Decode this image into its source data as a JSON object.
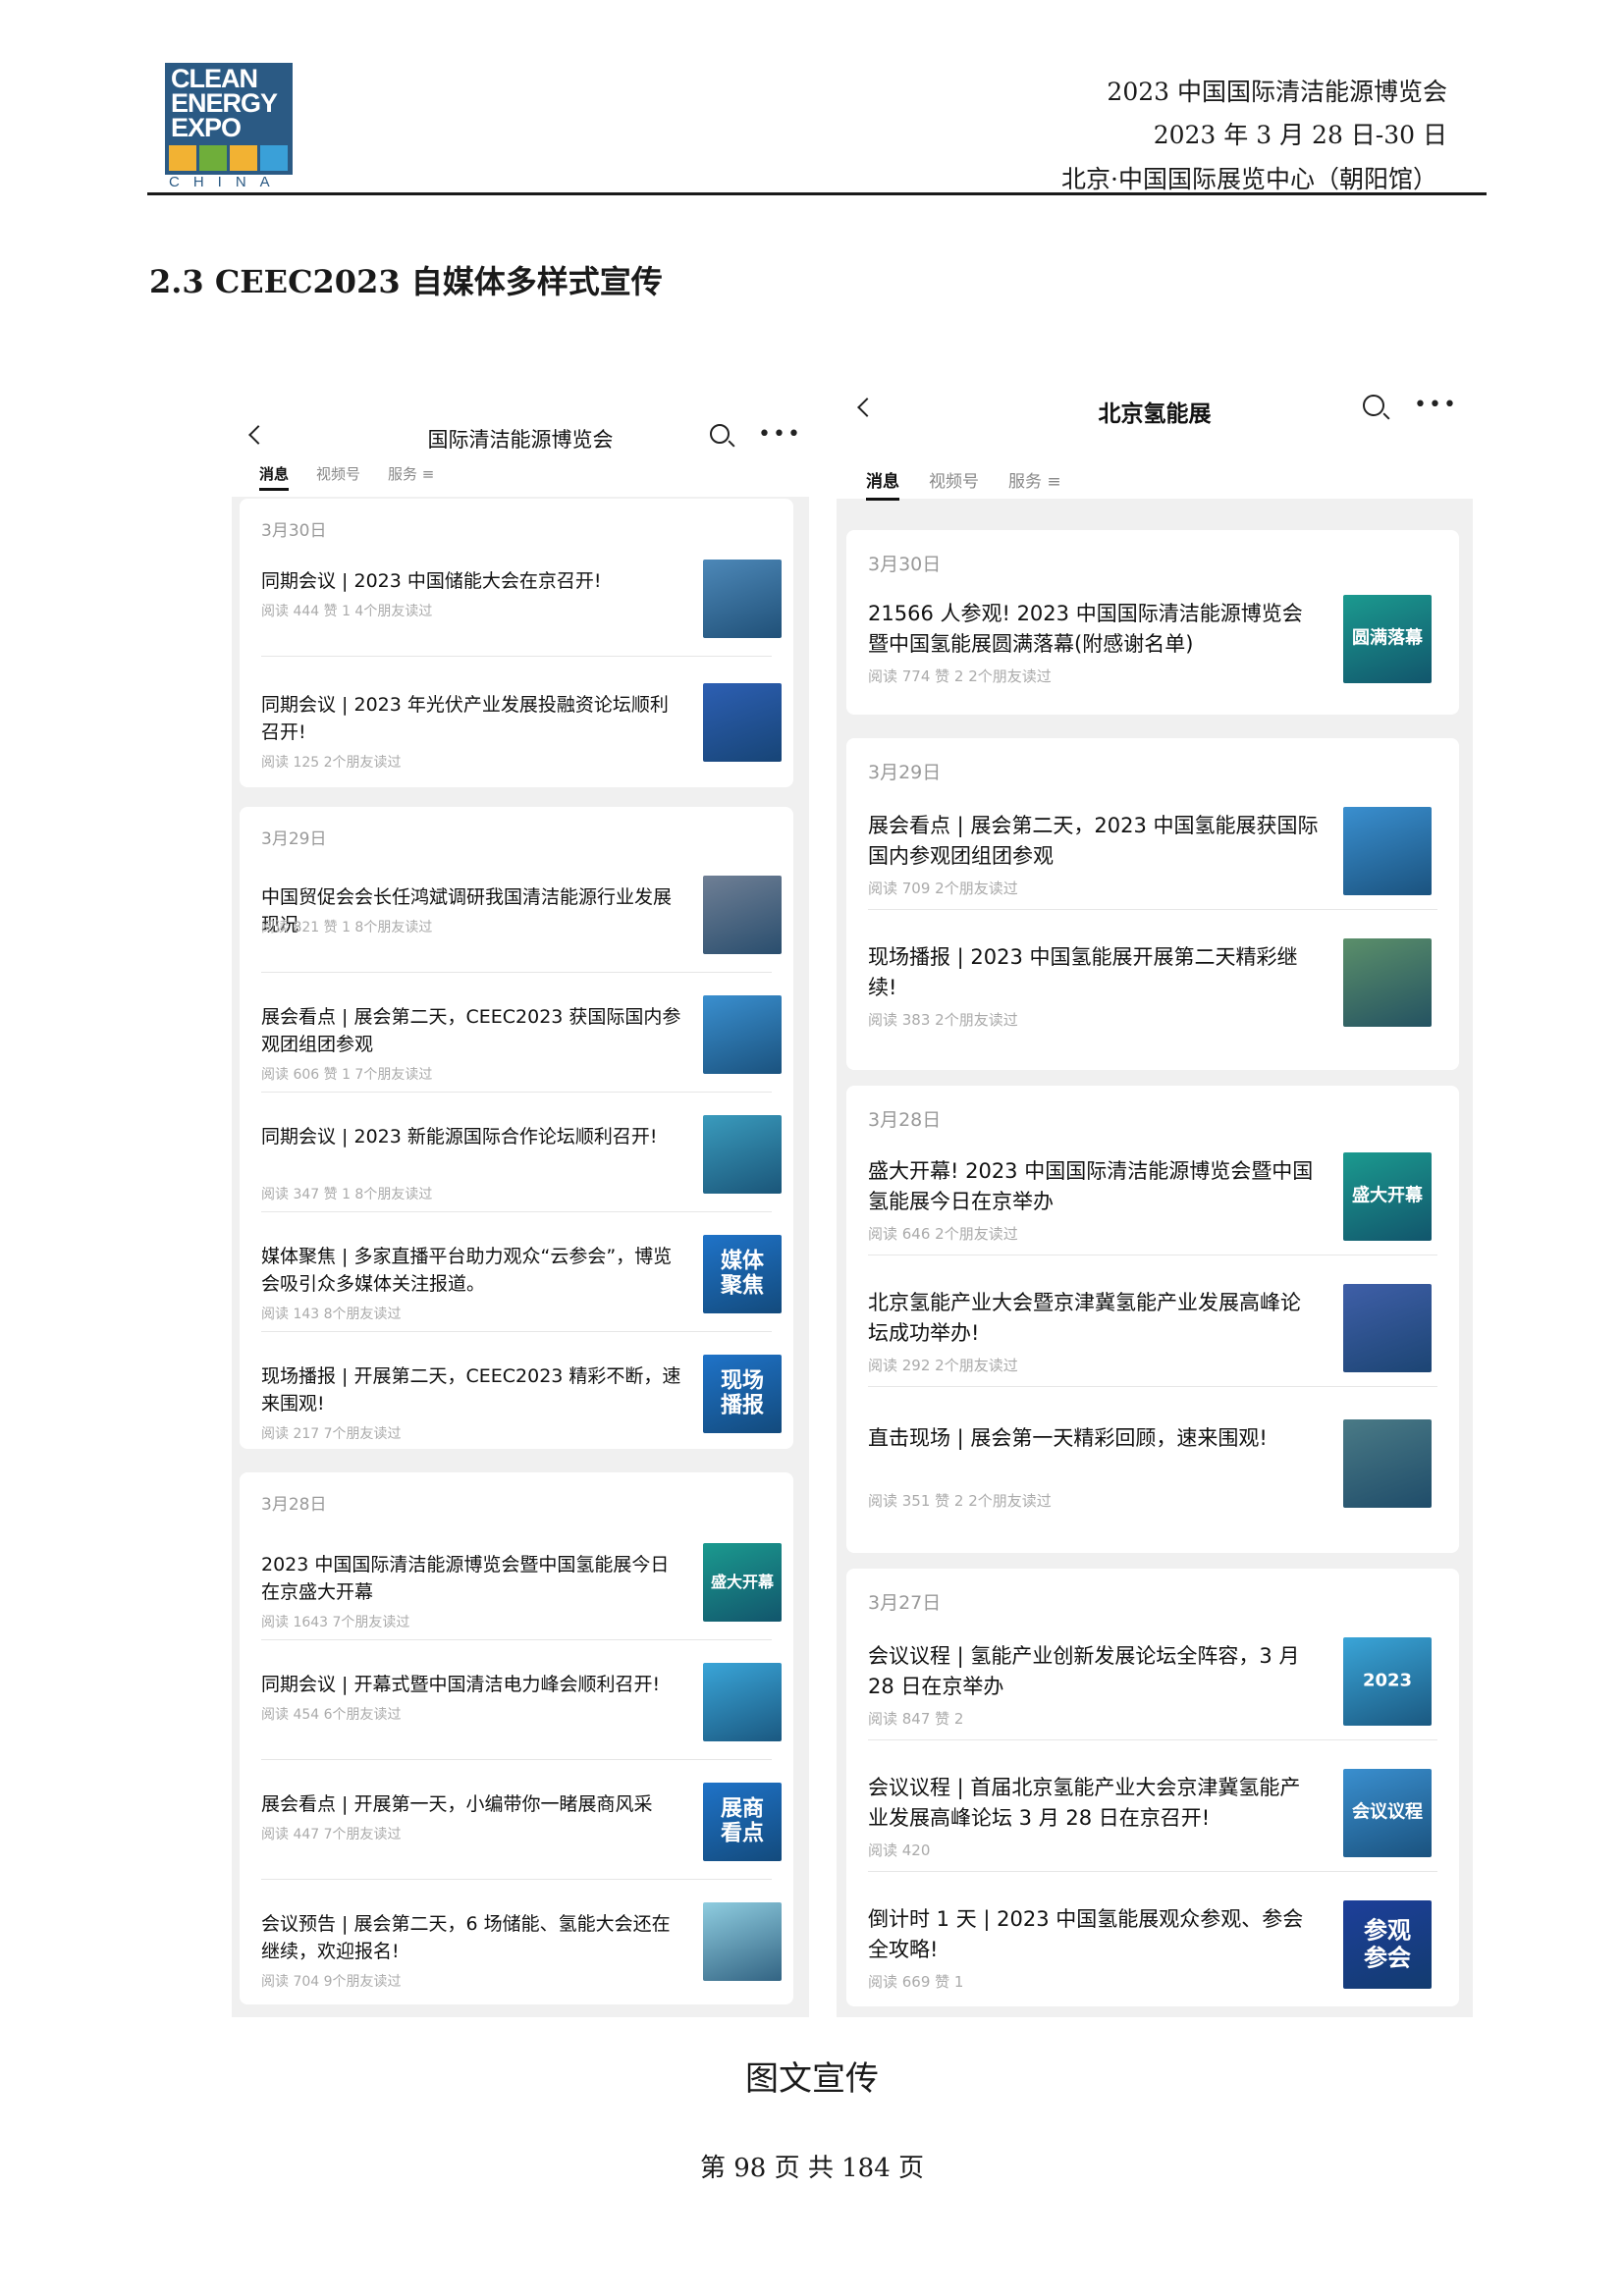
{
  "header": {
    "logo_lines": [
      "CLEAN",
      "ENERGY",
      "EXPO"
    ],
    "logo_bottom": "CHINA",
    "line1": "2023 中国国际清洁能源博览会",
    "line2": "2023 年 3 月 28 日-30 日",
    "line3": "北京·中国国际展览中心（朝阳馆）"
  },
  "section_title": "2.3 CEEC2023 自媒体多样式宣传",
  "left_phone": {
    "title": "国际清洁能源博览会",
    "tabs": [
      "消息",
      "视频号",
      "服务 ≡"
    ],
    "groups": [
      {
        "date": "3月30日",
        "items": [
          {
            "title": "同期会议 | 2023 中国储能大会在京召开!",
            "meta": "阅读 444  赞 1  4个朋友读过",
            "thumb_color": "#4d88b8",
            "thumb_text": ""
          },
          {
            "title": "同期会议 | 2023 年光伏产业发展投融资论坛顺利召开!",
            "meta": "阅读 125  2个朋友读过",
            "thumb_color": "#2d5fb3",
            "thumb_text": ""
          }
        ]
      },
      {
        "date": "3月29日",
        "items": [
          {
            "title": "中国贸促会会长任鸿斌调研我国清洁能源行业发展现况",
            "meta": "阅读 821  赞 1  8个朋友读过",
            "thumb_color": "#6f7f95",
            "thumb_text": ""
          },
          {
            "title": "展会看点 | 展会第二天，CEEC2023 获国际国内参观团组团参观",
            "meta": "阅读 606  赞 1  7个朋友读过",
            "thumb_color": "#3a8fcf",
            "thumb_text": ""
          },
          {
            "title": "同期会议 | 2023 新能源国际合作论坛顺利召开!",
            "meta": "阅读 347  赞 1  8个朋友读过",
            "thumb_color": "#3a9bbd",
            "thumb_text": ""
          },
          {
            "title": "媒体聚焦 | 多家直播平台助力观众“云参会”，博览会吸引众多媒体关注报道。",
            "meta": "阅读 143  8个朋友读过",
            "thumb_color": "#1f73c8",
            "thumb_text": "媒体\n聚焦"
          },
          {
            "title": "现场播报 | 开展第二天，CEEC2023 精彩不断，速来围观!",
            "meta": "阅读 217  7个朋友读过",
            "thumb_color": "#1f73c8",
            "thumb_text": "现场\n播报"
          }
        ]
      },
      {
        "date": "3月28日",
        "items": [
          {
            "title": "2023 中国国际清洁能源博览会暨中国氢能展今日在京盛大开幕",
            "meta": "阅读 1643  7个朋友读过",
            "thumb_color": "#1b9a8f",
            "thumb_text": "盛大开幕"
          },
          {
            "title": "同期会议 | 开幕式暨中国清洁电力峰会顺利召开!",
            "meta": "阅读 454  6个朋友读过",
            "thumb_color": "#3aa5d8",
            "thumb_text": ""
          },
          {
            "title": "展会看点 | 开展第一天，小编带你一睹展商风采",
            "meta": "阅读 447  7个朋友读过",
            "thumb_color": "#1f73c8",
            "thumb_text": "展商\n看点"
          },
          {
            "title": "会议预告 | 展会第二天，6 场储能、氢能大会还在继续，欢迎报名!",
            "meta": "阅读 704  9个朋友读过",
            "thumb_color": "#8fcde0",
            "thumb_text": ""
          }
        ]
      }
    ]
  },
  "right_phone": {
    "title": "北京氢能展",
    "tabs": [
      "消息",
      "视频号",
      "服务 ≡"
    ],
    "groups": [
      {
        "date": "3月30日",
        "items": [
          {
            "title": "21566 人参观! 2023 中国国际清洁能源博览会暨中国氢能展圆满落幕(附感谢名单)",
            "meta": "阅读 774  赞 2  2个朋友读过",
            "thumb_color": "#1b9a8f",
            "thumb_text": "圆满落幕"
          }
        ]
      },
      {
        "date": "3月29日",
        "items": [
          {
            "title": "展会看点 | 展会第二天，2023 中国氢能展获国际国内参观团组团参观",
            "meta": "阅读 709  2个朋友读过",
            "thumb_color": "#3a8fcf",
            "thumb_text": ""
          },
          {
            "title": "现场播报 | 2023 中国氢能展开展第二天精彩继续!",
            "meta": "阅读 383  2个朋友读过",
            "thumb_color": "#5b8f6a",
            "thumb_text": ""
          }
        ]
      },
      {
        "date": "3月28日",
        "items": [
          {
            "title": "盛大开幕! 2023 中国国际清洁能源博览会暨中国氢能展今日在京举办",
            "meta": "阅读 646  2个朋友读过",
            "thumb_color": "#1b9a8f",
            "thumb_text": "盛大开幕"
          },
          {
            "title": "北京氢能产业大会暨京津冀氢能产业发展高峰论坛成功举办!",
            "meta": "阅读 292  2个朋友读过",
            "thumb_color": "#3f5fa8",
            "thumb_text": ""
          },
          {
            "title": "直击现场 | 展会第一天精彩回顾，速来围观!",
            "meta": "阅读 351  赞 2  2个朋友读过",
            "thumb_color": "#4a7a86",
            "thumb_text": ""
          }
        ]
      },
      {
        "date": "3月27日",
        "items": [
          {
            "title": "会议议程 | 氢能产业创新发展论坛全阵容，3 月 28 日在京举办",
            "meta": "阅读 847  赞 2",
            "thumb_color": "#3aa5d8",
            "thumb_text": "2023"
          },
          {
            "title": "会议议程 | 首届北京氢能产业大会京津冀氢能产业发展高峰论坛 3 月 28 日在京召开!",
            "meta": "阅读 420",
            "thumb_color": "#3a8fcf",
            "thumb_text": "会议议程"
          },
          {
            "title": "倒计时 1 天 | 2023 中国氢能展观众参观、参会全攻略!",
            "meta": "阅读 669  赞 1",
            "thumb_color": "#1d3f9a",
            "thumb_text": "参观\n参会"
          }
        ]
      }
    ]
  },
  "caption": "图文宣传",
  "footer": "第 98 页 共 184 页"
}
